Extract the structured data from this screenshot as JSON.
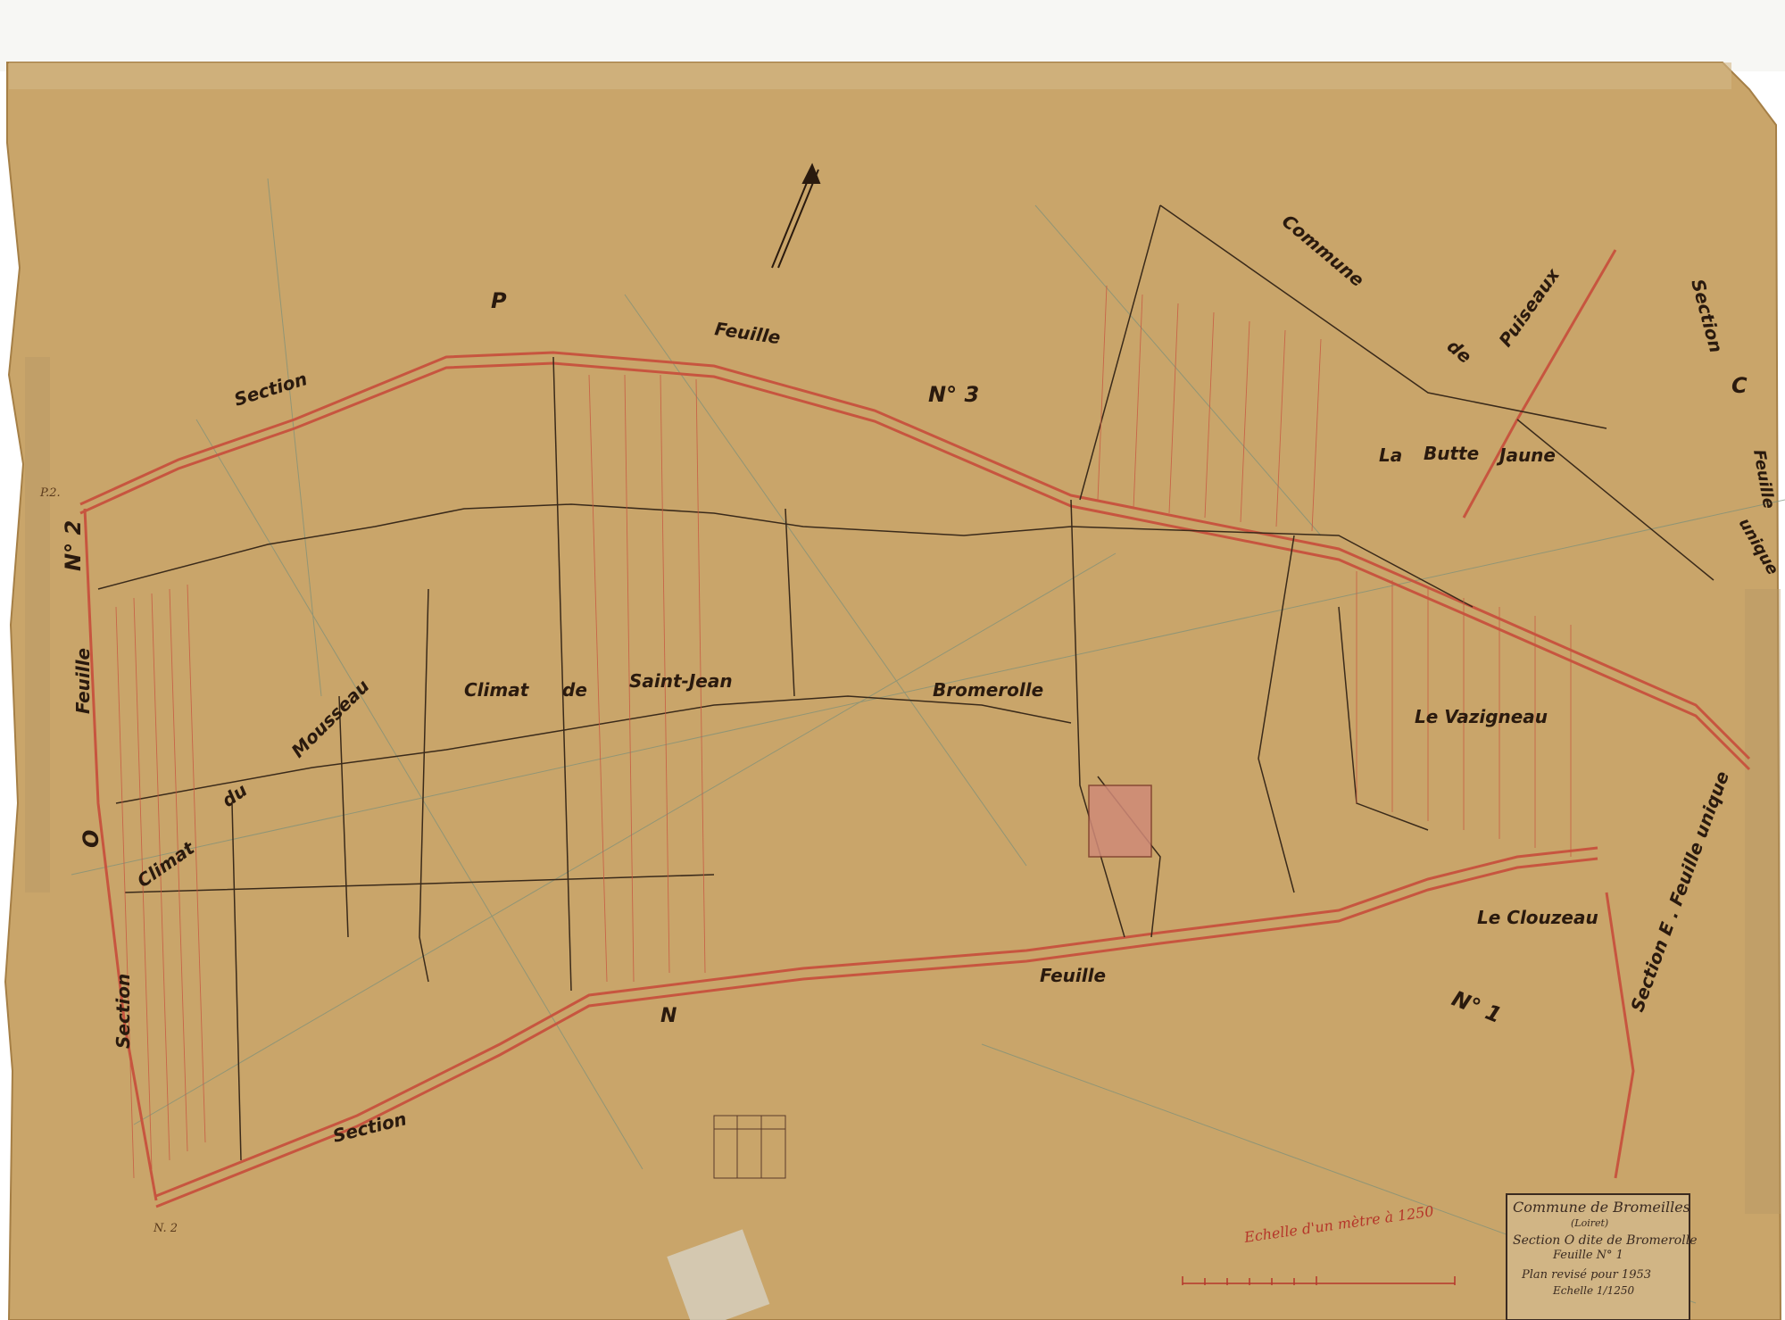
{
  "colors": {
    "paper": "#c9a56a",
    "paper_dark": "#b8925a",
    "ink_black": "#2a1a0e",
    "ink_red": "#c7553f",
    "ink_green": "#6d8f6e",
    "top_strip": "#f7f7f4"
  },
  "map": {
    "sections": {
      "top": "Section",
      "top_letter": "P",
      "left_letter": "O",
      "left_word": "Section",
      "bottom": "Section",
      "bottom_letter": "N",
      "right_word": "Section",
      "right_letter": "C",
      "right_lower": "Section E . Feuille unique"
    },
    "feuilles": {
      "top_word": "Feuille",
      "top_num": "N° 3",
      "left_word": "Feuille",
      "left_num": "N° 2",
      "bottom_word": "Feuille",
      "bottom_num": "N° 1",
      "right_word": "Feuille",
      "right_unique": "unique"
    },
    "commune_neighbor": {
      "w1": "Commune",
      "w2": "de",
      "w3": "Puiseaux"
    },
    "localities": {
      "climat_du_mousseau_1": "Climat",
      "climat_du_mousseau_2": "du",
      "climat_du_mousseau_3": "Mousseau",
      "climat_saint_jean_1": "Climat",
      "climat_saint_jean_2": "de",
      "climat_saint_jean_3": "Saint-Jean",
      "bromerolle": "Bromerolle",
      "la_butte_jaune_1": "La",
      "la_butte_jaune_2": "Butte",
      "la_butte_jaune_3": "Jaune",
      "le_vazigneau": "Le  Vazigneau",
      "le_clouzeau": "Le  Clouzeau"
    },
    "corner_marks": {
      "p2": "P.2.",
      "n2": "N. 2"
    },
    "cartouche": {
      "line1": "Commune de Bromeilles",
      "line2": "(Loiret)",
      "line3": "Section O dite de Bromerolle",
      "line4": "Feuille N° 1",
      "line5": "Plan revisé pour 1953",
      "line6": "Echelle 1/1250"
    },
    "scale_caption": "Echelle d'un mètre à 1250"
  }
}
